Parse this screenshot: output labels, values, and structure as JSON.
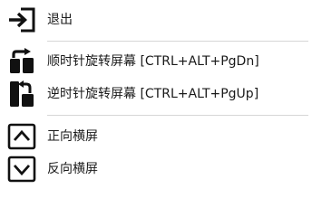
{
  "menu": {
    "items": [
      {
        "label": "退出",
        "icon": "exit-icon"
      },
      {
        "label": "顺时针旋转屏幕 [CTRL+ALT+PgDn]",
        "icon": "rotate-clockwise-icon"
      },
      {
        "label": "逆时针旋转屏幕 [CTRL+ALT+PgUp]",
        "icon": "rotate-counterclockwise-icon"
      },
      {
        "label": "正向横屏",
        "icon": "chevron-up-icon"
      },
      {
        "label": "反向横屏",
        "icon": "chevron-down-icon"
      }
    ]
  },
  "colors": {
    "background": "#ffffff",
    "text": "#1a1a1a",
    "icon": "#111111",
    "separator": "#d6d6d6"
  }
}
